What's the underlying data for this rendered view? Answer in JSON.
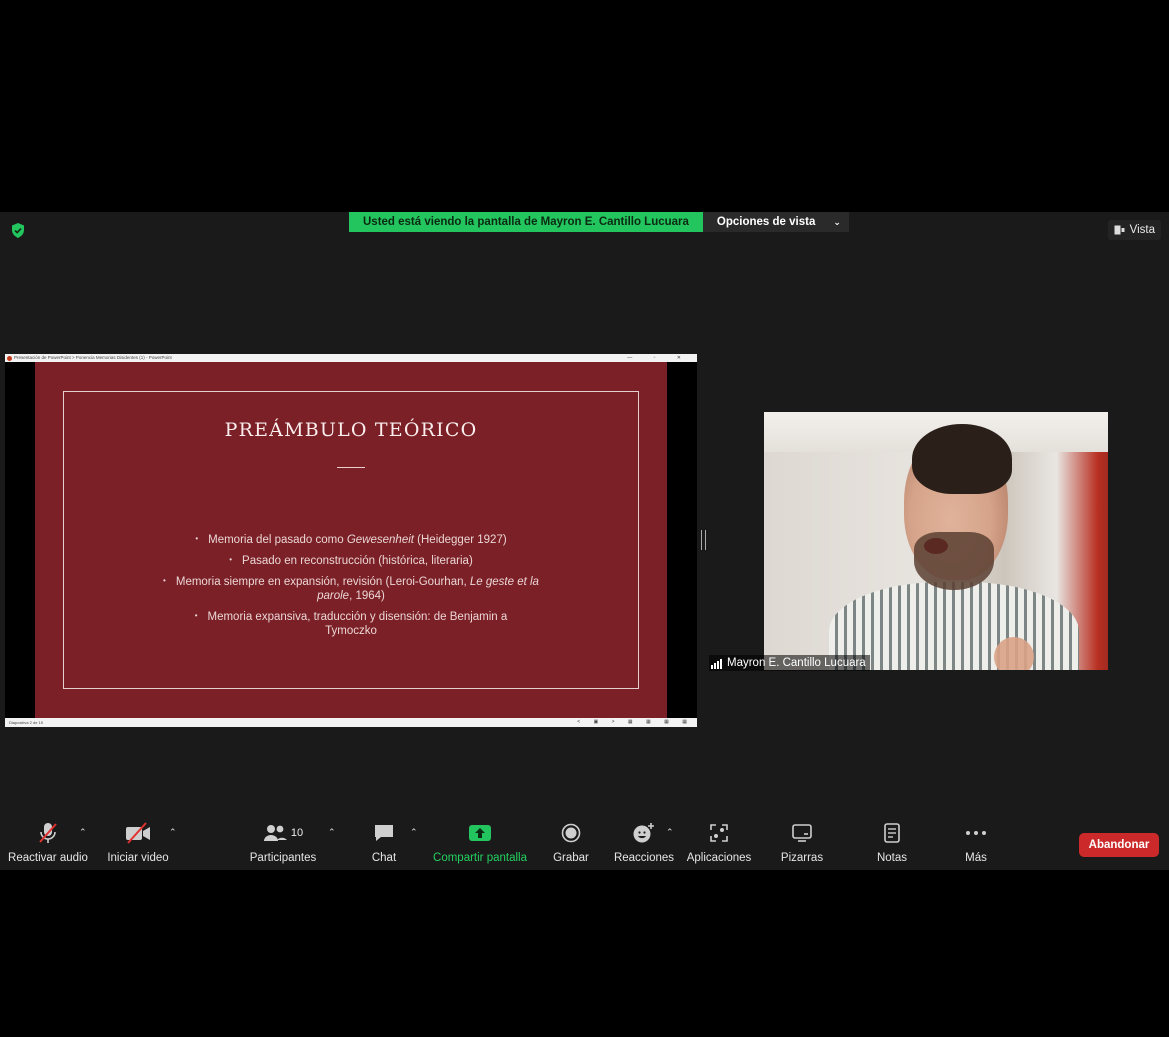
{
  "banner": {
    "sharing_text": "Usted está viendo la pantalla de Mayron E. Cantillo Lucuara",
    "view_options_label": "Opciones de vista",
    "view_button_label": "Vista"
  },
  "powerpoint": {
    "window_title": "Presentación de PowerPoint > Ponencia Memorias Disidentes (1) - PowerPoint",
    "window_buttons": "— ▫ ✕",
    "status_left": "Diapositiva 2 de 15",
    "status_right": "< ▣ > ▦ ▦ ▦ ▦",
    "slide": {
      "title": "PREÁMBULO TEÓRICO",
      "bullets": [
        {
          "pre": "Memoria del pasado como ",
          "em": "Gewesenheit",
          "post": " (Heidegger 1927)"
        },
        {
          "pre": "Pasado en reconstrucción (histórica, literaria)",
          "em": "",
          "post": ""
        },
        {
          "pre": "Memoria siempre en expansión, revisión (Leroi-Gourhan, ",
          "em": "Le geste et la parole",
          "post": ", 1964)"
        },
        {
          "pre": "Memoria expansiva, traducción y disensión: de Benjamin a Tymoczko",
          "em": "",
          "post": ""
        }
      ]
    }
  },
  "participant": {
    "name": "Mayron E. Cantillo Lucuara"
  },
  "toolbar": {
    "audio_label": "Reactivar audio",
    "video_label": "Iniciar video",
    "participants_label": "Participantes",
    "participants_count": "10",
    "chat_label": "Chat",
    "share_label": "Compartir pantalla",
    "record_label": "Grabar",
    "reactions_label": "Reacciones",
    "apps_label": "Aplicaciones",
    "whiteboards_label": "Pizarras",
    "notes_label": "Notas",
    "more_label": "Más",
    "leave_label": "Abandonar"
  },
  "colors": {
    "share_green": "#23c55e",
    "slide_bg": "#7a2026",
    "leave_red": "#cc2a2a"
  }
}
